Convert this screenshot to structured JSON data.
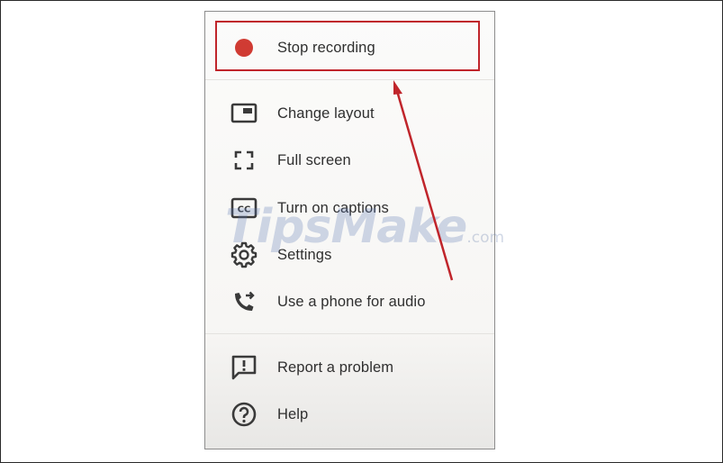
{
  "menu": {
    "items": [
      {
        "label": "Stop recording",
        "icon": "record-dot-icon"
      },
      {
        "label": "Change layout",
        "icon": "layout-icon"
      },
      {
        "label": "Full screen",
        "icon": "fullscreen-icon"
      },
      {
        "label": "Turn on captions",
        "icon": "captions-icon"
      },
      {
        "label": "Settings",
        "icon": "gear-icon"
      },
      {
        "label": "Use a phone for audio",
        "icon": "phone-audio-icon"
      },
      {
        "label": "Report a problem",
        "icon": "feedback-icon"
      },
      {
        "label": "Help",
        "icon": "help-icon"
      }
    ]
  },
  "watermark": {
    "brand": "TipsMake",
    "suffix": ".com"
  },
  "colors": {
    "record": "#d03b33",
    "highlight_box": "#c0252b",
    "icon": "#3a3a3a",
    "text": "#2f2f2f"
  }
}
